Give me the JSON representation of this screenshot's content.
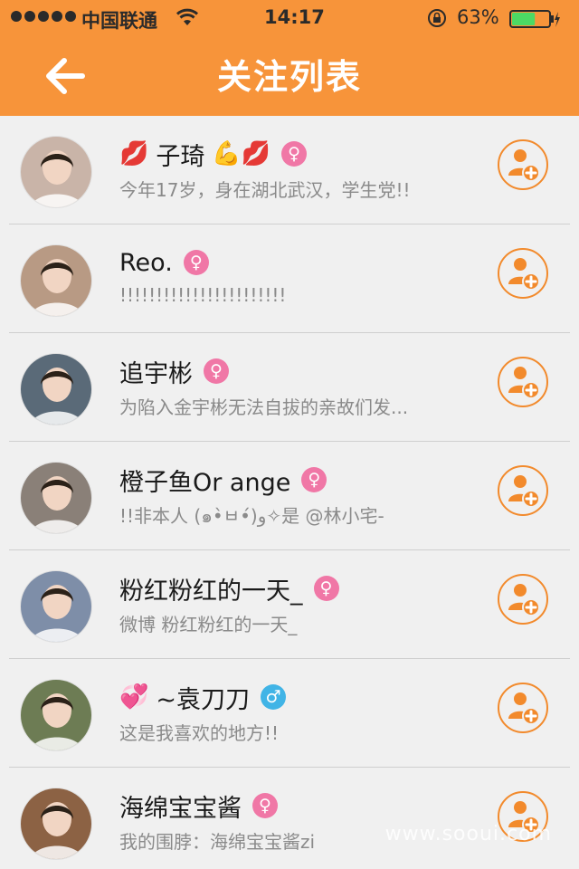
{
  "status_bar": {
    "carrier": "中国联通",
    "time": "14:17",
    "battery": "63%",
    "signal_icon": "signal-dots-icon",
    "wifi_icon": "wifi-icon",
    "lock_icon": "rotation-lock-icon",
    "battery_icon": "battery-icon",
    "battery_level": 0.63
  },
  "nav": {
    "back_icon": "back-arrow-icon",
    "title": "关注列表"
  },
  "colors": {
    "accent": "#f7943a",
    "follow": "#f28a2c",
    "female": "#f077a6",
    "male": "#41b4e6"
  },
  "users": [
    {
      "name": "子琦",
      "prefix": "💋",
      "suffix": "💪💋",
      "gender": "♀",
      "gender_type": "female",
      "signature": "今年17岁，身在湖北武汉，学生党!!",
      "avatar_color": "#c9b4a8"
    },
    {
      "name": "Reo.",
      "prefix": "",
      "suffix": "",
      "gender": "♀",
      "gender_type": "female",
      "signature": "!!!!!!!!!!!!!!!!!!!!!!!",
      "avatar_color": "#b89a84"
    },
    {
      "name": "追宇彬",
      "prefix": "",
      "suffix": "",
      "gender": "♀",
      "gender_type": "female",
      "signature": "为陷入金宇彬无法自拔的亲故们发...",
      "avatar_color": "#5a6a78"
    },
    {
      "name": "橙子鱼Or ange",
      "prefix": "",
      "suffix": "",
      "gender": "♀",
      "gender_type": "female",
      "signature": "!!非本人 (๑•̀ㅂ•́)و✧是 @林小宅-",
      "avatar_color": "#8a8078"
    },
    {
      "name": "粉红粉红的一天_",
      "prefix": "",
      "suffix": "",
      "gender": "♀",
      "gender_type": "female",
      "signature": "微博 粉红粉红的一天_",
      "avatar_color": "#7e8ea8"
    },
    {
      "name": "~袁刀刀",
      "prefix": "💞",
      "suffix": "",
      "gender": "♂",
      "gender_type": "male",
      "signature": "这是我喜欢的地方!!",
      "avatar_color": "#6d7c54"
    },
    {
      "name": "海绵宝宝酱",
      "prefix": "",
      "suffix": "",
      "gender": "♀",
      "gender_type": "female",
      "signature": "我的围脖：海绵宝宝酱zi",
      "avatar_color": "#8c6244"
    }
  ],
  "follow_icon": "add-user-icon",
  "watermark": "www.sooui.com"
}
